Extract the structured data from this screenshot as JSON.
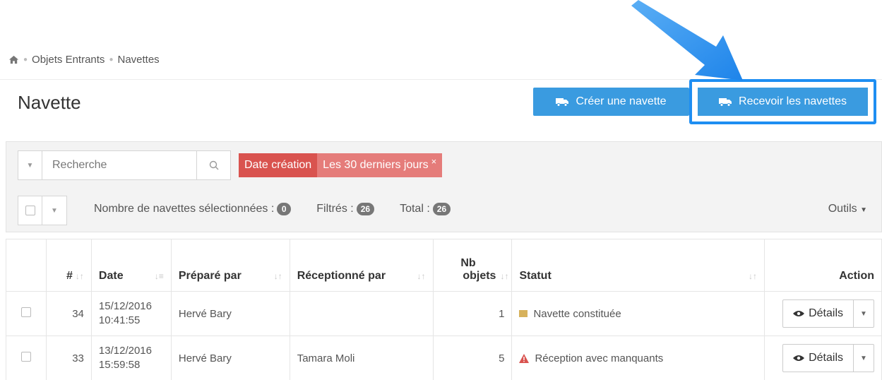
{
  "breadcrumb": {
    "items": [
      "Objets Entrants",
      "Navettes"
    ]
  },
  "page": {
    "title": "Navette"
  },
  "actions": {
    "create_label": "Créer une navette",
    "receive_label": "Recevoir les navettes"
  },
  "filters": {
    "search_placeholder": "Recherche",
    "active_filter_key": "Date création",
    "active_filter_value": "Les 30 derniers jours",
    "close_symbol": "×"
  },
  "stats": {
    "selected_label": "Nombre de navettes sélectionnées :",
    "selected_count": "0",
    "filtered_label": "Filtrés :",
    "filtered_count": "26",
    "total_label": "Total :",
    "total_count": "26",
    "tools_label": "Outils"
  },
  "table": {
    "headers": {
      "id": "#",
      "date": "Date",
      "prepared_by": "Préparé par",
      "received_by": "Réceptionné par",
      "nb_objects_line1": "Nb",
      "nb_objects_line2": "objets",
      "status": "Statut",
      "action": "Action"
    },
    "rows": [
      {
        "id": "34",
        "date": "15/12/2016",
        "time": "10:41:55",
        "prepared_by": "Hervé Bary",
        "received_by": "",
        "nb_objects": "1",
        "status": "Navette constituée",
        "status_icon": "package-icon",
        "status_color": "#d7b25c",
        "action_label": "Détails"
      },
      {
        "id": "33",
        "date": "13/12/2016",
        "time": "15:59:58",
        "prepared_by": "Hervé Bary",
        "received_by": "Tamara Moli",
        "nb_objects": "5",
        "status": "Réception avec manquants",
        "status_icon": "warning-icon",
        "status_color": "#d9534f",
        "action_label": "Détails"
      }
    ]
  },
  "colors": {
    "primary": "#3a9be0",
    "highlight": "#1e8ef2",
    "danger": "#d9534f",
    "link": "#3f6f96"
  }
}
